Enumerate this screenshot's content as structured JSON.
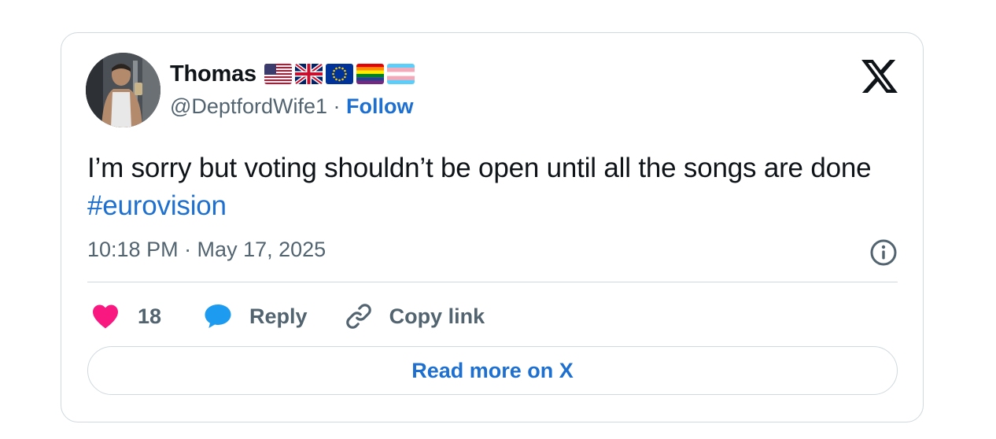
{
  "author": {
    "display_name": "Thomas",
    "handle": "@DeptfordWife1",
    "separator": "·",
    "follow_label": "Follow",
    "flags": [
      "us-flag-icon",
      "uk-flag-icon",
      "eu-flag-icon",
      "rainbow-flag-icon",
      "trans-flag-icon"
    ]
  },
  "tweet": {
    "text": "I’m sorry but voting shouldn’t be open until all the songs are done ",
    "hashtag": "#eurovision",
    "timestamp": "10:18 PM · May 17, 2025"
  },
  "actions": {
    "like_count": "18",
    "reply_label": "Reply",
    "copy_link_label": "Copy link"
  },
  "footer": {
    "read_more_label": "Read more on X"
  },
  "colors": {
    "link": "#1d6fd0",
    "secondary_text": "#536471",
    "border": "#cfd9de",
    "like": "#f91880",
    "reply": "#1d9bf0"
  }
}
